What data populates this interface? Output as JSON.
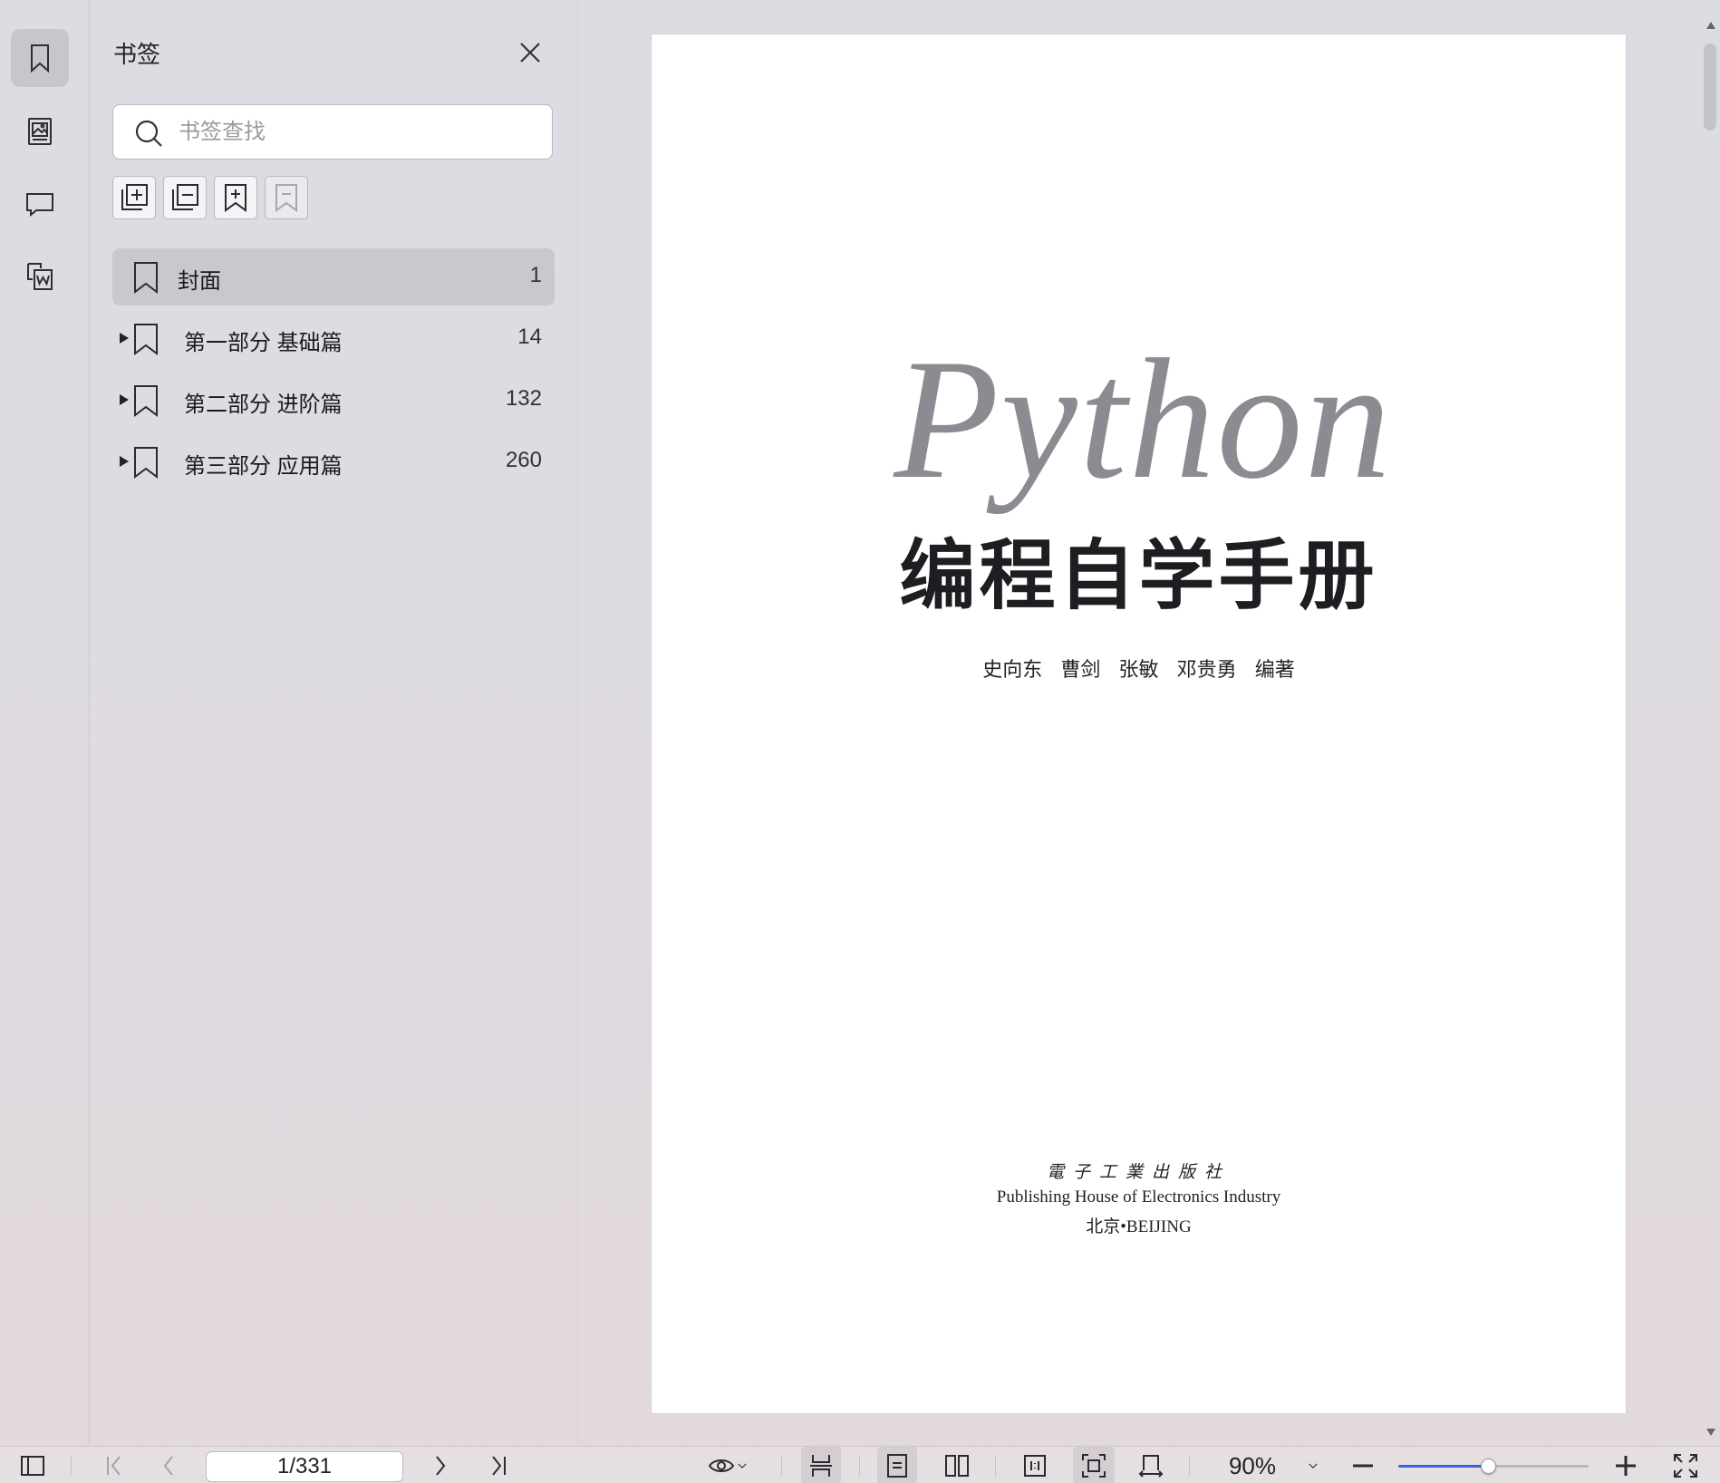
{
  "panel": {
    "title": "书签",
    "search_placeholder": "书签查找",
    "bookmarks": [
      {
        "label": "封面",
        "page": "1"
      },
      {
        "label": "第一部分 基础篇",
        "page": "14"
      },
      {
        "label": "第二部分 进阶篇",
        "page": "132"
      },
      {
        "label": "第三部分 应用篇",
        "page": "260"
      }
    ]
  },
  "rail": {
    "icons": [
      "bookmark-icon",
      "thumbnail-icon",
      "comment-icon",
      "convert-to-word-icon"
    ]
  },
  "document": {
    "python": "Python",
    "title": "编程自学手册",
    "authors": "史向东 曹剑 张敏 邓贵勇 编著",
    "publisher_cn": "電子工業出版社",
    "publisher_en": "Publishing House of Electronics Industry",
    "city": "北京•BEIJING"
  },
  "toolbar": {
    "page_indicator": "1/331",
    "zoom": "90%",
    "zoom_fraction": 0.47
  },
  "colors": {
    "accent": "#3a63d8",
    "selected_row": "#c9c8cf"
  }
}
